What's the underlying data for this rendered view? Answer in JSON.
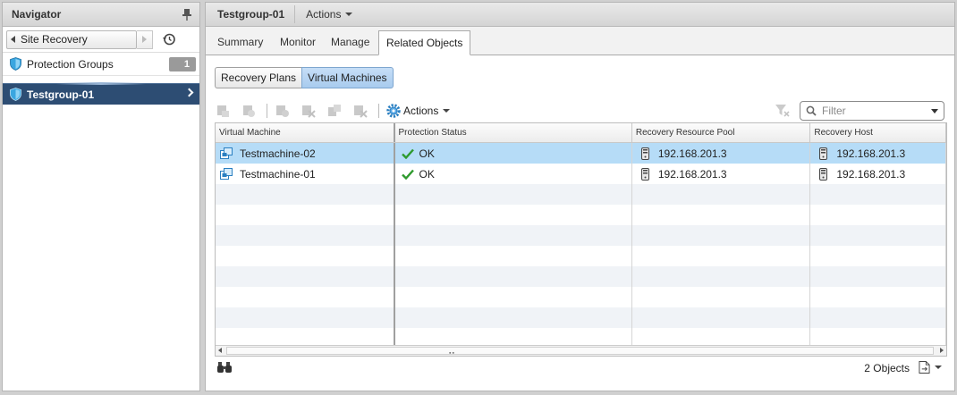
{
  "navigator": {
    "title": "Navigator",
    "back_label": "Site Recovery",
    "items": [
      {
        "label": "Protection Groups",
        "count": "1"
      },
      {
        "label": "Testgroup-01"
      }
    ]
  },
  "main": {
    "title": "Testgroup-01",
    "actions_label": "Actions",
    "tabs": [
      "Summary",
      "Monitor",
      "Manage",
      "Related Objects"
    ],
    "active_tab": "Related Objects",
    "subtabs": [
      "Recovery Plans",
      "Virtual Machines"
    ],
    "active_subtab": "Virtual Machines",
    "toolbar": {
      "actions_label": "Actions",
      "filter_placeholder": "Filter"
    },
    "grid": {
      "columns": [
        "Virtual Machine",
        "Protection Status",
        "Recovery Resource Pool",
        "Recovery Host"
      ],
      "rows": [
        {
          "vm": "Testmachine-02",
          "status": "OK",
          "pool": "192.168.201.3",
          "host": "192.168.201.3",
          "selected": true
        },
        {
          "vm": "Testmachine-01",
          "status": "OK",
          "pool": "192.168.201.3",
          "host": "192.168.201.3",
          "selected": false
        }
      ]
    },
    "footer": {
      "count": "2 Objects"
    }
  },
  "colors": {
    "accent": "#2d4d73",
    "selection": "#b6dcf7",
    "ok": "#2e9a2e",
    "vm_icon": "#2a7fc1"
  },
  "icons": [
    "pin-icon",
    "history-icon",
    "shield-icon",
    "gear-icon",
    "search-icon",
    "clear-filter-icon",
    "vm-icon",
    "check-icon",
    "host-icon",
    "binoculars-icon",
    "export-icon"
  ]
}
